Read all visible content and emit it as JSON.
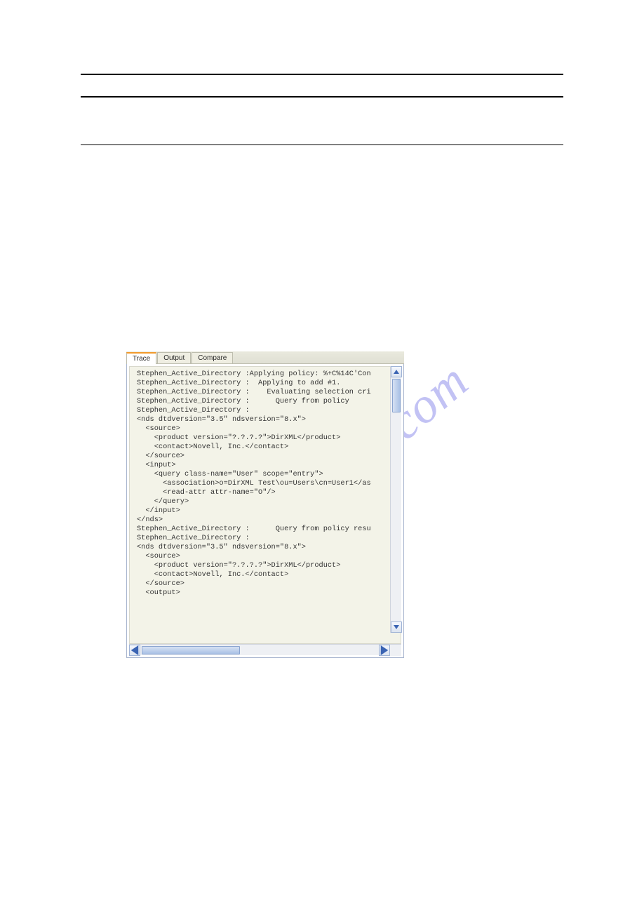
{
  "watermark": "manualshive.com",
  "tabs": [
    {
      "label": "Trace",
      "active": true
    },
    {
      "label": "Output",
      "active": false
    },
    {
      "label": "Compare",
      "active": false
    }
  ],
  "trace_lines": [
    "Stephen_Active_Directory :Applying policy: %+C%14C'Con",
    "Stephen_Active_Directory :  Applying to add #1.",
    "Stephen_Active_Directory :    Evaluating selection cri",
    "Stephen_Active_Directory :      Query from policy",
    "Stephen_Active_Directory :",
    "<nds dtdversion=\"3.5\" ndsversion=\"8.x\">",
    "  <source>",
    "    <product version=\"?.?.?.?\">DirXML</product>",
    "    <contact>Novell, Inc.</contact>",
    "  </source>",
    "  <input>",
    "    <query class-name=\"User\" scope=\"entry\">",
    "      <association>o=DirXML Test\\ou=Users\\cn=User1</as",
    "      <read-attr attr-name=\"O\"/>",
    "    </query>",
    "  </input>",
    "</nds>",
    "Stephen_Active_Directory :      Query from policy resu",
    "Stephen_Active_Directory :",
    "<nds dtdversion=\"3.5\" ndsversion=\"8.x\">",
    "  <source>",
    "    <product version=\"?.?.?.?\">DirXML</product>",
    "    <contact>Novell, Inc.</contact>",
    "  </source>",
    "  <output>"
  ]
}
